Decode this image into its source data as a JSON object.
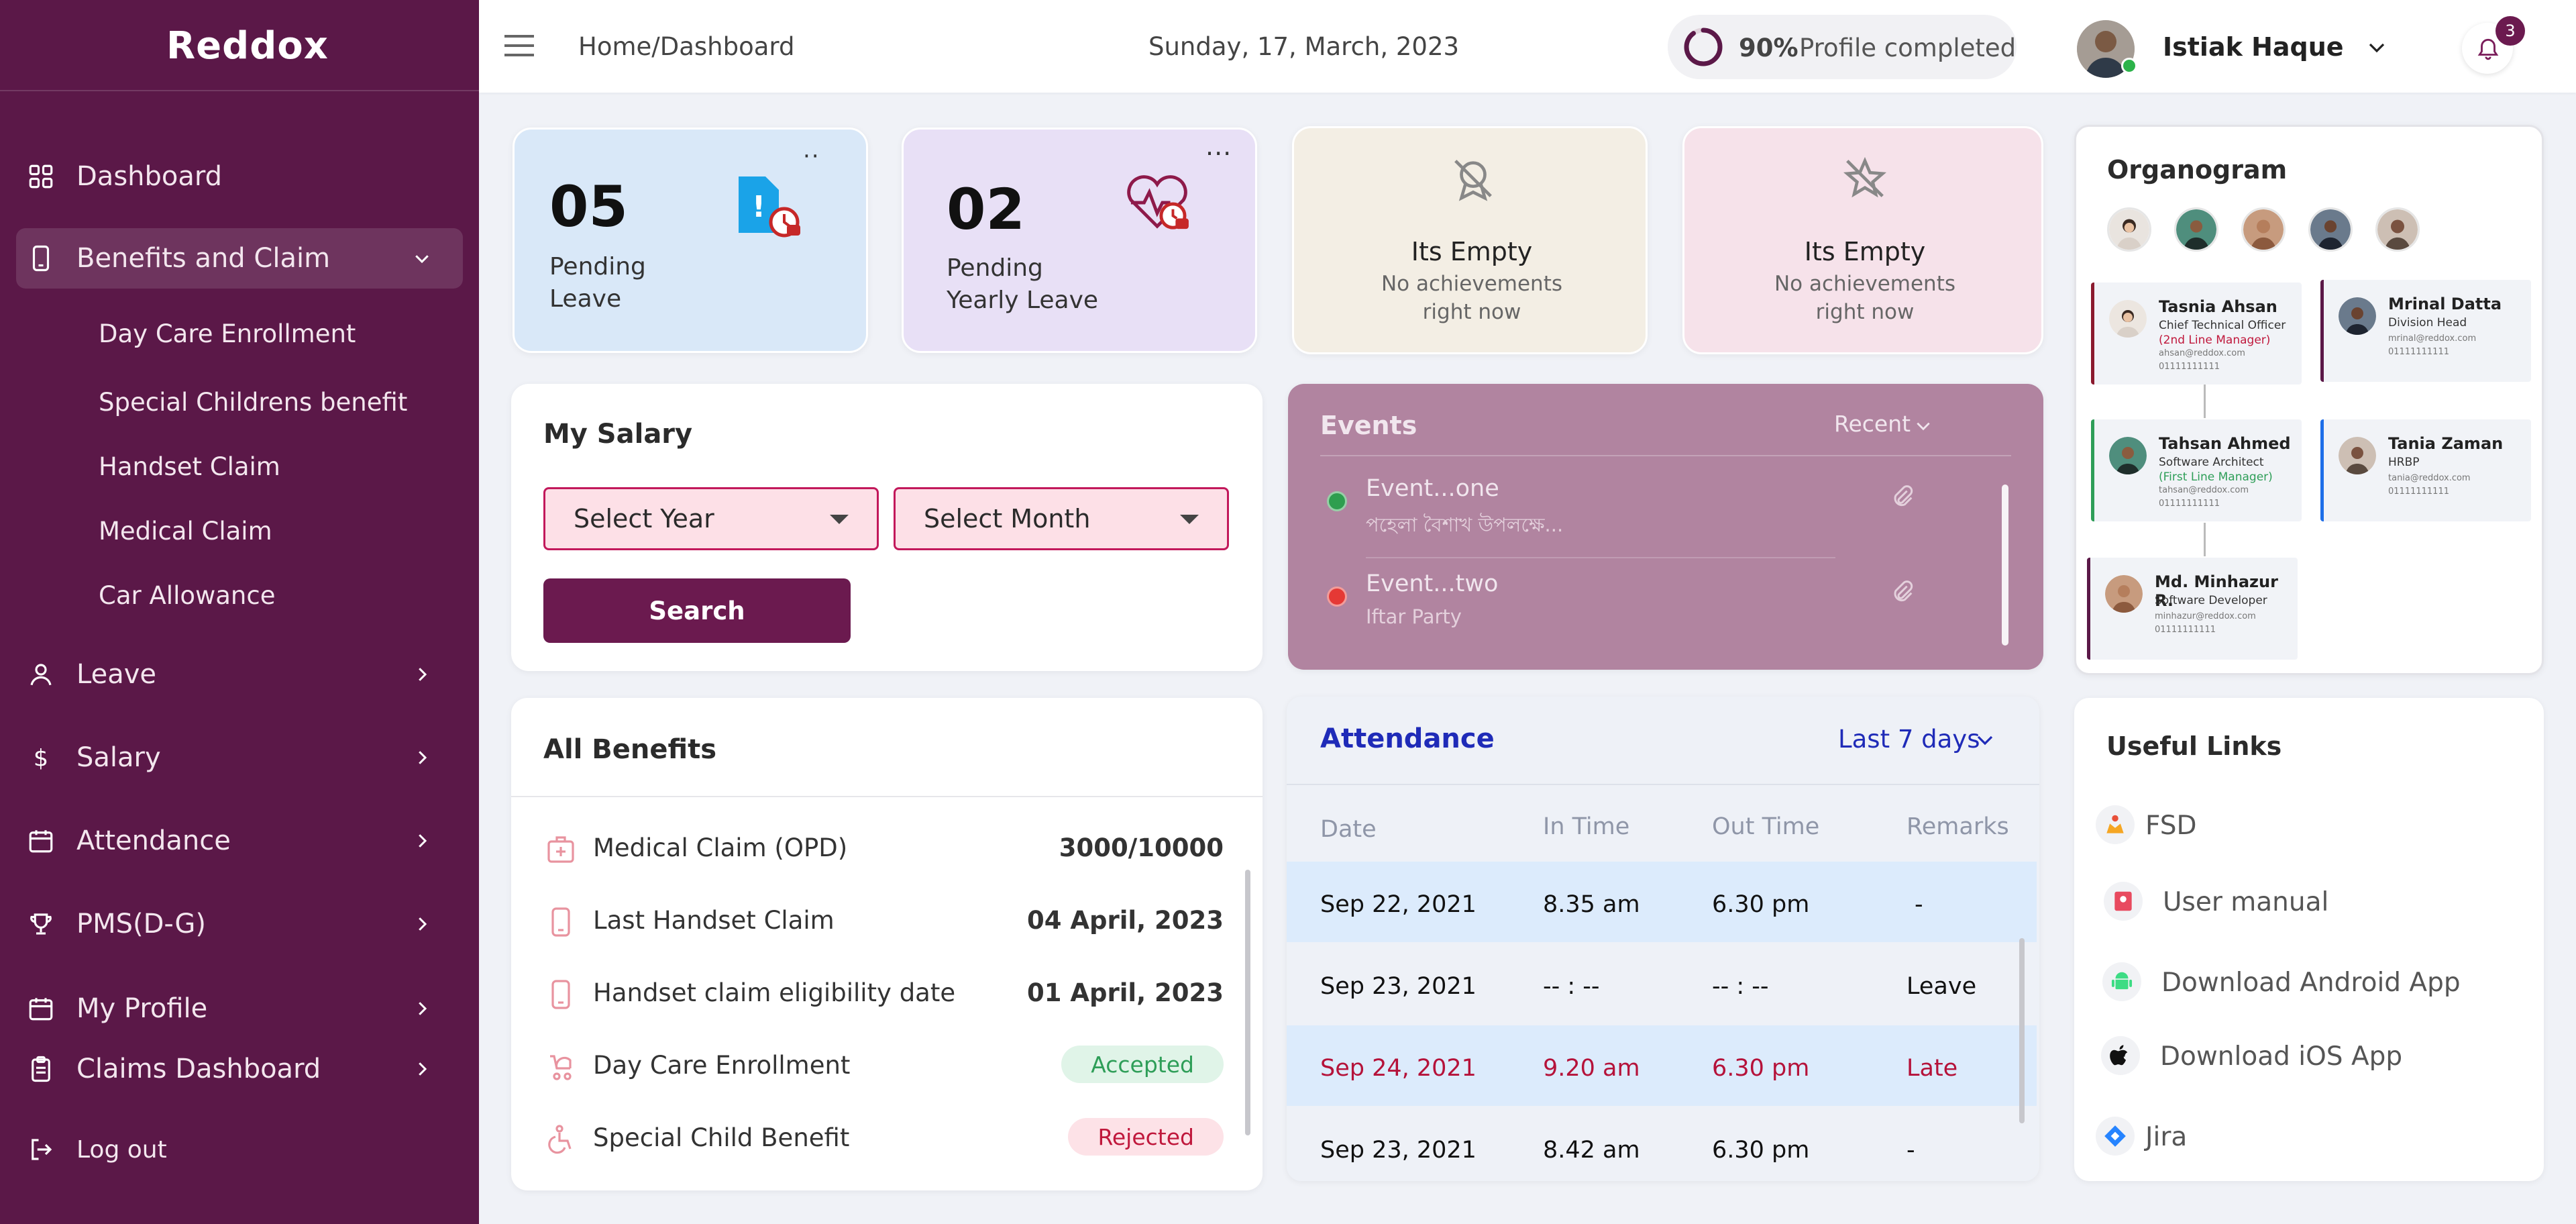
{
  "brand": {
    "logo": "Reddox"
  },
  "sidebar": {
    "items": [
      {
        "label": "Dashboard"
      },
      {
        "label": "Benefits and Claim"
      },
      {
        "label": "Leave"
      },
      {
        "label": "Salary"
      },
      {
        "label": "Attendance"
      },
      {
        "label": "PMS(D-G)"
      },
      {
        "label": "My Profile"
      },
      {
        "label": "Claims Dashboard"
      },
      {
        "label": "Log out"
      }
    ],
    "subitems": [
      {
        "label": "Day Care Enrollment"
      },
      {
        "label": "Special Childrens benefit"
      },
      {
        "label": "Handset Claim"
      },
      {
        "label": "Medical Claim"
      },
      {
        "label": "Car Allowance"
      }
    ]
  },
  "header": {
    "breadcrumb": "Home/Dashboard",
    "date": "Sunday, 17, March, 2023",
    "profile_percent": "90%",
    "profile_text": "Profile completed",
    "profile_progress": 0.9,
    "user_name": "Istiak Haque",
    "notification_count": "3"
  },
  "stats": [
    {
      "value": "05",
      "label_line1": "Pending",
      "label_line2": "Leave",
      "menu": "··"
    },
    {
      "value": "02",
      "label_line1": "Pending",
      "label_line2": "Yearly Leave",
      "menu": "···"
    }
  ],
  "achievements": [
    {
      "title": "Its Empty",
      "line1": "No achievements",
      "line2": "right now"
    },
    {
      "title": "Its Empty",
      "line1": "No achievements",
      "line2": "right now"
    }
  ],
  "salary": {
    "title": "My Salary",
    "year_select": "Select Year",
    "month_select": "Select Month",
    "search_label": "Search"
  },
  "events": {
    "title": "Events",
    "filter": "Recent",
    "items": [
      {
        "name": "Event...one",
        "desc": "পহেলা বৈশাখ উপলক্ষে...",
        "status_color": "#2e9e4f"
      },
      {
        "name": "Event...two",
        "desc": "Iftar Party",
        "status_color": "#e53935"
      }
    ]
  },
  "benefits": {
    "title": "All Benefits",
    "rows": [
      {
        "label": "Medical Claim (OPD)",
        "value": "3000/10000"
      },
      {
        "label": "Last Handset Claim",
        "value": "04 April, 2023"
      },
      {
        "label": "Handset claim eligibility date",
        "value": "01 April, 2023"
      },
      {
        "label": "Day Care Enrollment",
        "status": "Accepted"
      },
      {
        "label": "Special Child Benefit",
        "status": "Rejected"
      }
    ]
  },
  "attendance": {
    "title": "Attendance",
    "filter": "Last 7 days",
    "columns": [
      "Date",
      "In Time",
      "Out Time",
      "Remarks"
    ],
    "rows": [
      {
        "date": "Sep 22, 2021",
        "in": "8.35 am",
        "out": "6.30 pm",
        "remarks": "-"
      },
      {
        "date": "Sep 23, 2021",
        "in": "-- : --",
        "out": "-- : --",
        "remarks": "Leave"
      },
      {
        "date": "Sep 24, 2021",
        "in": "9.20 am",
        "out": "6.30 pm",
        "remarks": "Late"
      },
      {
        "date": "Sep 23, 2021",
        "in": "8.42 am",
        "out": "6.30 pm",
        "remarks": "-"
      }
    ]
  },
  "organogram": {
    "title": "Organogram",
    "people": [
      {
        "name": "Tasnia Ahsan",
        "role": "Chief Technical Officer",
        "manager": "(2nd Line Manager)",
        "email": "ahsan@reddox.com",
        "phone": "01111111111"
      },
      {
        "name": "Mrinal Datta",
        "role": "Division Head",
        "email": "mrinal@reddox.com",
        "phone": "01111111111"
      },
      {
        "name": "Tahsan Ahmed",
        "role": "Software Architect",
        "manager": "(First Line Manager)",
        "email": "tahsan@reddox.com",
        "phone": "01111111111"
      },
      {
        "name": "Tania Zaman",
        "role": "HRBP",
        "email": "tania@reddox.com",
        "phone": "01111111111"
      },
      {
        "name": "Md. Minhazur R.",
        "role": "Software Developer",
        "email": "minhazur@reddox.com",
        "phone": "01111111111"
      }
    ]
  },
  "links": {
    "title": "Useful Links",
    "items": [
      {
        "label": "FSD",
        "icon": "fsd-icon"
      },
      {
        "label": "User manual",
        "icon": "manual-icon"
      },
      {
        "label": "Download Android App",
        "icon": "android-icon"
      },
      {
        "label": "Download iOS App",
        "icon": "apple-icon"
      },
      {
        "label": "Jira",
        "icon": "jira-icon"
      }
    ]
  },
  "colors": {
    "brand": "#5b1848",
    "accent_pink": "#c2185b",
    "attendance_blue": "#1f2bb8"
  }
}
